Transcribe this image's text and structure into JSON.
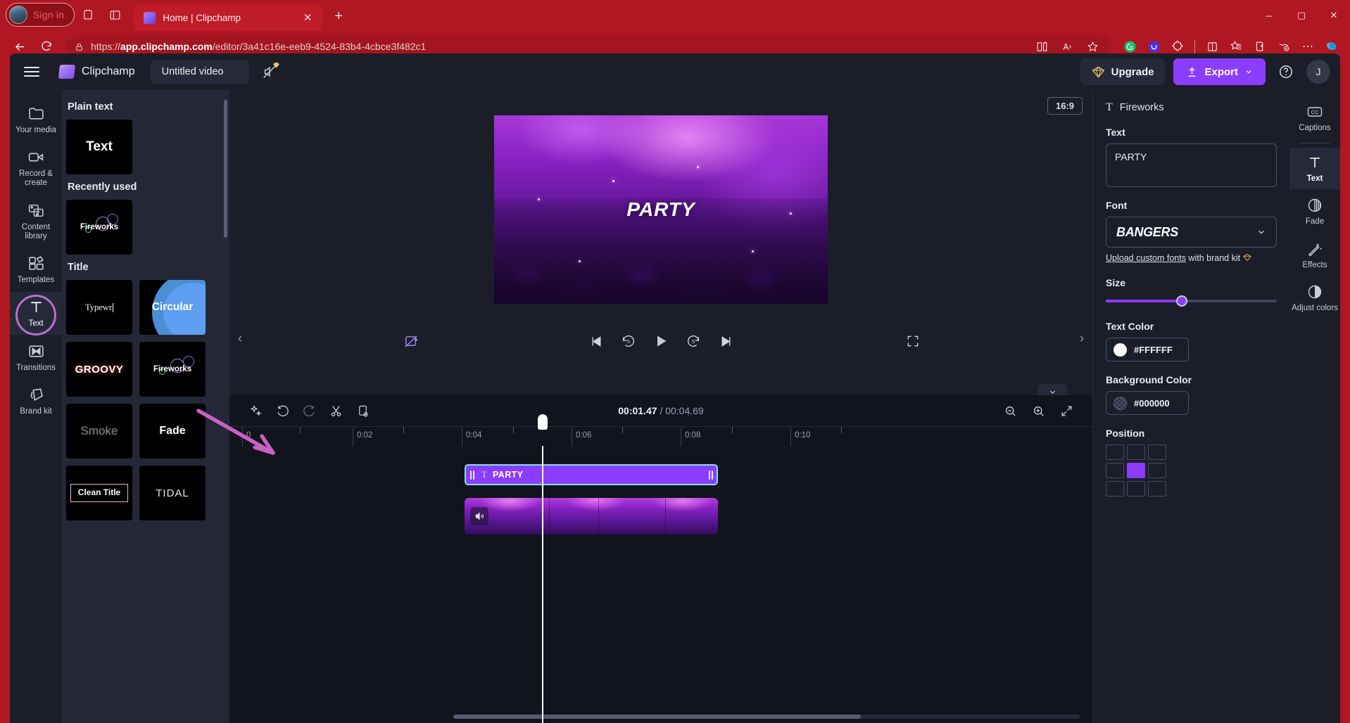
{
  "browser": {
    "signin_label": "Sign in",
    "tab_title": "Home | Clipchamp",
    "url_prefix": "https://",
    "url_host": "app.clipchamp.com",
    "url_path": "/editor/3a41c16e-eeb9-4524-83b4-4cbce3f482c1",
    "icons": {
      "collections": "collections-icon",
      "split_screen": "split-screen-icon",
      "new_tab": "new-tab-icon",
      "close_tab": "close-tab-icon",
      "back": "back-arrow-icon",
      "reload": "reload-icon",
      "lock": "lock-icon",
      "split_view": "split-view-icon",
      "read_aloud": "read-aloud-icon",
      "favorite": "star-icon",
      "grammarly": "grammarly-extension-icon",
      "wallet": "wallet-extension-icon",
      "extensions": "extensions-puzzle-icon",
      "browser_essentials": "browser-essentials-icon",
      "favorites_bar": "favorites-list-icon",
      "add_collection": "add-to-collections-icon",
      "settings_more": "more-options-icon",
      "copilot": "copilot-icon",
      "minimize": "minimize-icon",
      "maximize": "maximize-icon",
      "close_window": "close-window-icon"
    }
  },
  "header": {
    "menu_icon": "hamburger-menu-icon",
    "brand": "Clipchamp",
    "project_name": "Untitled video",
    "audio_icon": "no-audio-premium-icon",
    "upgrade_label": "Upgrade",
    "export_label": "Export",
    "help_icon": "help-icon",
    "avatar_initial": "J"
  },
  "left_rail": {
    "items": [
      {
        "label": "Your media",
        "icon": "folder-icon",
        "active": false
      },
      {
        "label": "Record & create",
        "icon": "camera-icon",
        "active": false
      },
      {
        "label": "Content library",
        "icon": "content-library-icon",
        "active": false
      },
      {
        "label": "Templates",
        "icon": "templates-icon",
        "active": false
      },
      {
        "label": "Text",
        "icon": "text-icon",
        "active": true
      },
      {
        "label": "Transitions",
        "icon": "transitions-icon",
        "active": false
      },
      {
        "label": "Brand kit",
        "icon": "brand-kit-icon",
        "active": false
      }
    ]
  },
  "panel": {
    "sections": [
      {
        "heading": "Plain text",
        "tiles": [
          {
            "label": "Text",
            "style": "plain"
          }
        ]
      },
      {
        "heading": "Recently used",
        "tiles": [
          {
            "label": "Fireworks",
            "style": "fireworks"
          }
        ]
      },
      {
        "heading": "Title",
        "tiles": [
          {
            "label": "Typewr",
            "style": "typewriter"
          },
          {
            "label": "Circular",
            "style": "circular"
          },
          {
            "label": "GROOVY",
            "style": "groovy"
          },
          {
            "label": "Fireworks",
            "style": "fireworks"
          },
          {
            "label": "Smoke",
            "style": "smoke"
          },
          {
            "label": "Fade",
            "style": "fade"
          },
          {
            "label": "Clean Title",
            "style": "clean"
          },
          {
            "label": "TIDAL",
            "style": "tidal"
          }
        ]
      }
    ]
  },
  "stage": {
    "aspect_ratio": "16:9",
    "video_title": "PARTY",
    "controls": {
      "ai_icon": "ai-magic-icon",
      "skip_start": "skip-to-start-icon",
      "back5": "back-5-seconds-icon",
      "play": "play-icon",
      "forward5": "forward-5-seconds-icon",
      "skip_end": "skip-to-end-icon",
      "fullscreen": "fullscreen-icon",
      "prev_panel": "collapse-left-icon",
      "next_panel": "collapse-right-icon",
      "collapse": "collapse-down-icon"
    }
  },
  "timeline": {
    "tools": {
      "ai": "ai-suggest-icon",
      "undo": "undo-icon",
      "redo": "redo-icon",
      "split": "split-scissors-icon",
      "duplicate": "duplicate-icon",
      "zoom_out": "zoom-out-icon",
      "zoom_in": "zoom-in-icon",
      "fit": "fit-to-timeline-icon"
    },
    "current_time": "00:01.47",
    "total_time": "00:04.69",
    "time_separator": "/",
    "ruler_labels": [
      "0",
      "0:02",
      "0:04",
      "0:06",
      "0:08",
      "0:10"
    ],
    "clips": [
      {
        "type": "text",
        "label": "PARTY",
        "icon": "text-clip-icon",
        "selected": true
      },
      {
        "type": "video",
        "label": "",
        "icon": "mute-speaker-icon",
        "selected": false
      }
    ]
  },
  "props": {
    "title": "Fireworks",
    "title_icon": "text-icon",
    "text_label": "Text",
    "text_value": "PARTY",
    "font_label": "Font",
    "font_value": "BANGERS",
    "upload_link": "Upload custom fonts",
    "upload_suffix": " with brand kit ",
    "upload_badge": "diamond-icon",
    "size_label": "Size",
    "size_percent": 43,
    "text_color_label": "Text Color",
    "text_color_value": "#FFFFFF",
    "bg_color_label": "Background Color",
    "bg_color_value": "#000000",
    "position_label": "Position",
    "position_selected_index": 4
  },
  "right_rail": {
    "items": [
      {
        "label": "Captions",
        "icon": "captions-cc-icon",
        "active": false
      },
      {
        "label": "Text",
        "icon": "text-icon",
        "active": true
      },
      {
        "label": "Fade",
        "icon": "fade-icon",
        "active": false
      },
      {
        "label": "Effects",
        "icon": "effects-wand-icon",
        "active": false
      },
      {
        "label": "Adjust colors",
        "icon": "adjust-colors-icon",
        "active": false
      }
    ]
  },
  "annotation": {
    "arrow": "pink-pointer-arrow",
    "color": "#c961c2"
  }
}
